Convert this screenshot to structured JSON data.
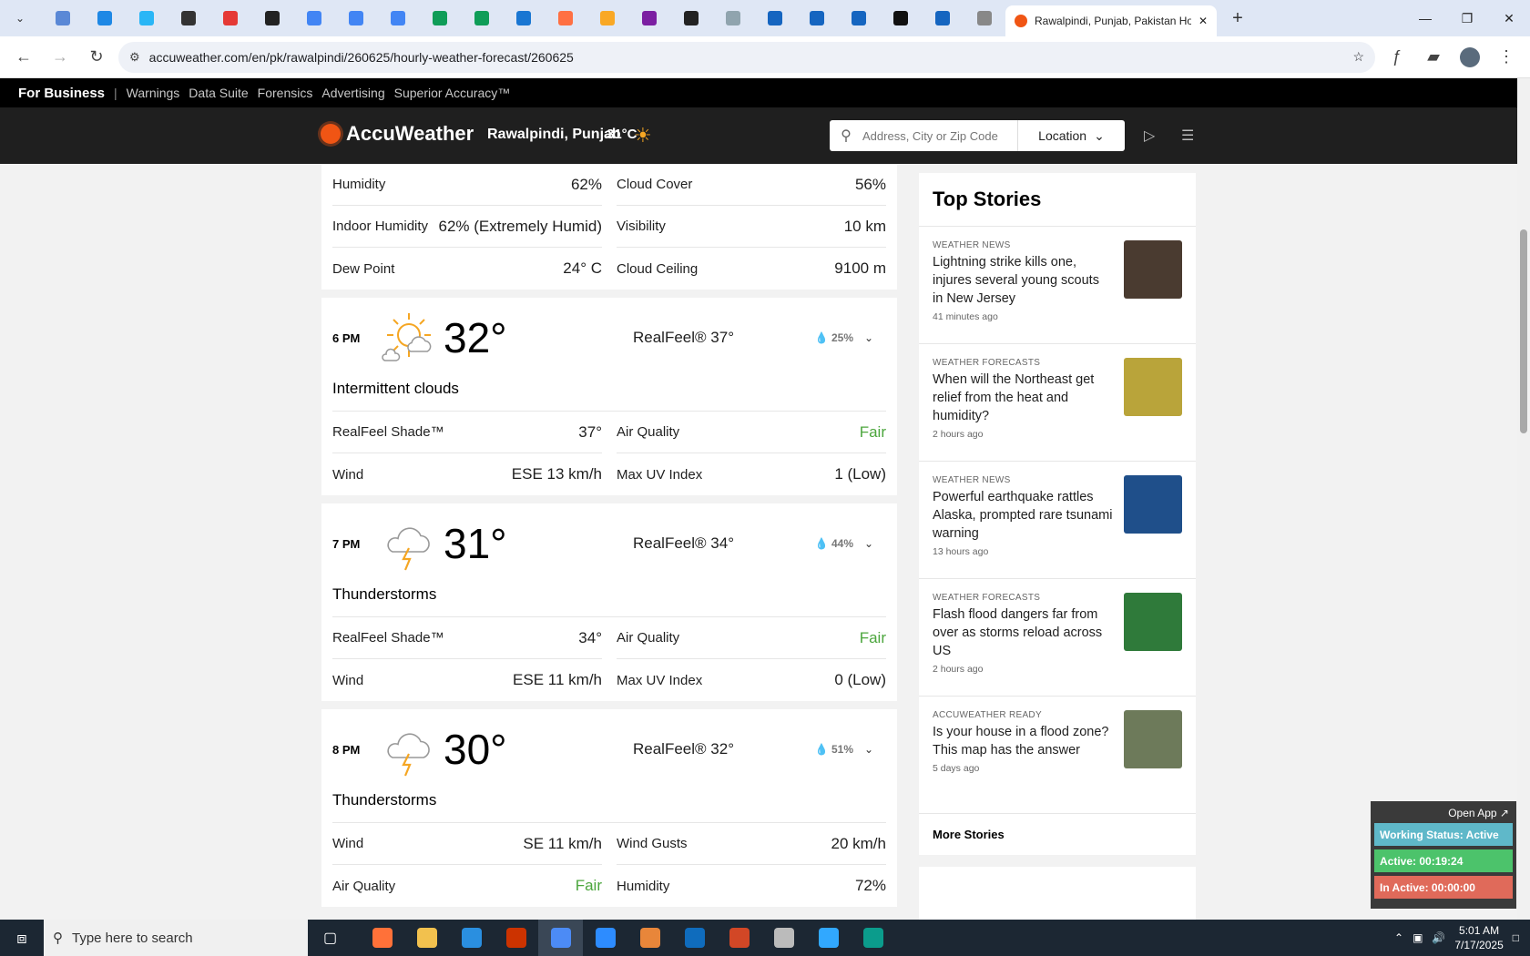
{
  "browser": {
    "active_tab_title": "Rawalpindi, Punjab, Pakistan Ho",
    "url": "accuweather.com/en/pk/rawalpindi/260625/hourly-weather-forecast/260625",
    "favicon_colors": [
      "#5a88d6",
      "#1e88e5",
      "#29b6f6",
      "#333333",
      "#e53935",
      "#222222",
      "#4285f4",
      "#4285f4",
      "#4285f4",
      "#0f9d58",
      "#0f9d58",
      "#1976d2",
      "#ff7043",
      "#f9a825",
      "#7b1fa2",
      "#222222",
      "#90a4ae",
      "#1565c0",
      "#1565c0",
      "#1565c0",
      "#111111",
      "#1565c0",
      "#888888"
    ]
  },
  "bizbar": {
    "for_business": "For Business",
    "separator": "|",
    "links": [
      "Warnings",
      "Data Suite",
      "Forensics",
      "Advertising",
      "Superior Accuracy™"
    ]
  },
  "header": {
    "logo": "AccuWeather",
    "location": "Rawalpindi, Punjab",
    "temp": "31°C",
    "search_placeholder": "Address, City or Zip Code",
    "location_button": "Location"
  },
  "current_details": {
    "rows": [
      [
        "Humidity",
        "62%",
        "Cloud Cover",
        "56%"
      ],
      [
        "Indoor Humidity",
        "62% (Extremely Humid)",
        "Visibility",
        "10 km"
      ],
      [
        "Dew Point",
        "24° C",
        "Cloud Ceiling",
        "9100 m"
      ]
    ]
  },
  "hours": [
    {
      "time": "6 PM",
      "temp": "32°",
      "realfeel": "RealFeel® 37°",
      "precip": "25%",
      "phrase": "Intermittent clouds",
      "icon": "partly-cloudy-icon",
      "rows": [
        [
          "RealFeel Shade™",
          "37°",
          "Air Quality",
          "Fair"
        ],
        [
          "Wind",
          "ESE 13 km/h",
          "Max UV Index",
          "1 (Low)"
        ]
      ]
    },
    {
      "time": "7 PM",
      "temp": "31°",
      "realfeel": "RealFeel® 34°",
      "precip": "44%",
      "phrase": "Thunderstorms",
      "icon": "thunderstorm-icon",
      "rows": [
        [
          "RealFeel Shade™",
          "34°",
          "Air Quality",
          "Fair"
        ],
        [
          "Wind",
          "ESE 11 km/h",
          "Max UV Index",
          "0 (Low)"
        ]
      ]
    },
    {
      "time": "8 PM",
      "temp": "30°",
      "realfeel": "RealFeel® 32°",
      "precip": "51%",
      "phrase": "Thunderstorms",
      "icon": "thunderstorm-icon",
      "rows": [
        [
          "Wind",
          "SE 11 km/h",
          "Wind Gusts",
          "20 km/h"
        ],
        [
          "Air Quality",
          "Fair",
          "Humidity",
          "72%"
        ]
      ]
    }
  ],
  "top_stories": {
    "title": "Top Stories",
    "more": "More Stories",
    "items": [
      {
        "category": "WEATHER NEWS",
        "headline": "Lightning strike kills one, injures several young scouts in New Jersey",
        "ago": "41 minutes ago",
        "thumb_color": "#4a3b30"
      },
      {
        "category": "WEATHER FORECASTS",
        "headline": "When will the Northeast get relief from the heat and humidity?",
        "ago": "2 hours ago",
        "thumb_color": "#b9a43a"
      },
      {
        "category": "WEATHER NEWS",
        "headline": "Powerful earthquake rattles Alaska, prompted rare tsunami warning",
        "ago": "13 hours ago",
        "thumb_color": "#1f4f8a"
      },
      {
        "category": "WEATHER FORECASTS",
        "headline": "Flash flood dangers far from over as storms reload across US",
        "ago": "2 hours ago",
        "thumb_color": "#2f7a3a"
      },
      {
        "category": "ACCUWEATHER READY",
        "headline": "Is your house in a flood zone? This map has the answer",
        "ago": "5 days ago",
        "thumb_color": "#6d7a5a"
      }
    ]
  },
  "widget": {
    "open_app": "Open App ↗",
    "status": "Working Status: Active",
    "active": "Active: 00:19:24",
    "inactive": "In Active: 00:00:00",
    "status_color": "#5fb8c9",
    "active_color": "#4cc36b",
    "inactive_color": "#e06a5a"
  },
  "taskbar": {
    "search_placeholder": "Type here to search",
    "time": "5:01 AM",
    "date": "7/17/2025",
    "app_colors": [
      "#ff7139",
      "#f2c14e",
      "#2a8fe0",
      "#cc3300",
      "#4c8bf5",
      "#2d8cff",
      "#e8863a",
      "#0f6cbd",
      "#d24726",
      "#bbbbbb",
      "#31a8ff",
      "#0b9c8c"
    ]
  }
}
